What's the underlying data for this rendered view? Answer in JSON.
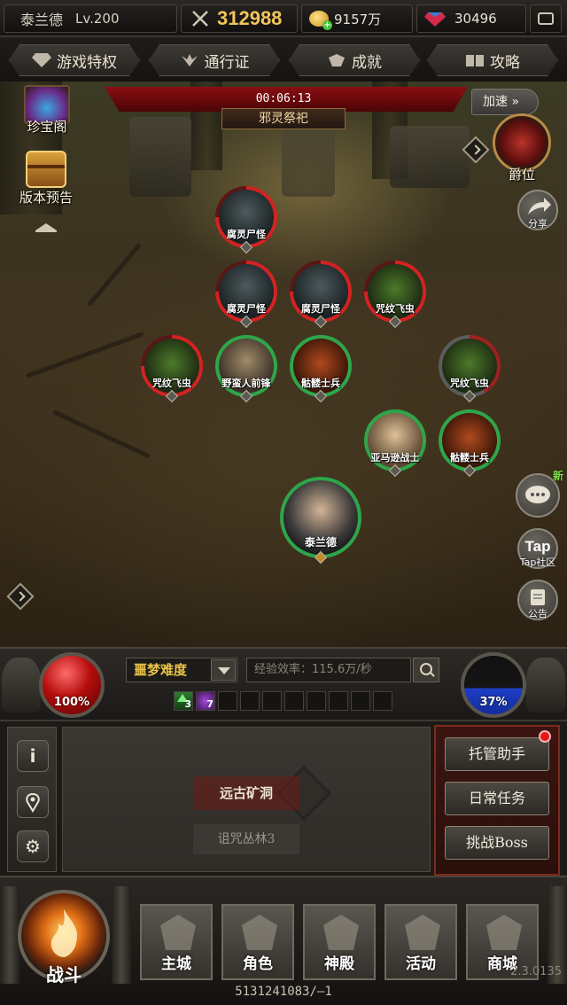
{
  "player": {
    "name": "泰兰德",
    "level": "Lv.200",
    "power": "312988"
  },
  "resources": {
    "gold": "9157万",
    "gems": "30496"
  },
  "nav": [
    "游戏特权",
    "通行证",
    "成就",
    "攻略"
  ],
  "event": {
    "timer": "00:06:13",
    "name": "邪灵祭祀",
    "speedup": "加速 »"
  },
  "side_left": {
    "treasure": "珍宝阁",
    "preview": "版本预告"
  },
  "side_right": {
    "rank": "爵位",
    "share": "分享",
    "chat_new": "新",
    "tap": "Tap",
    "tap_label": "Tap社区",
    "notice": "公告"
  },
  "units": [
    {
      "name": "腐灵尸怪",
      "side": "enemy",
      "face": "ghoul"
    },
    {
      "name": "腐灵尸怪",
      "side": "enemy",
      "face": "ghoul"
    },
    {
      "name": "腐灵尸怪",
      "side": "enemy",
      "face": "ghoul"
    },
    {
      "name": "咒纹飞虫",
      "side": "enemy",
      "face": "bug"
    },
    {
      "name": "咒纹飞虫",
      "side": "enemy",
      "face": "bug"
    },
    {
      "name": "野蛮人前锋",
      "side": "ally",
      "face": "viking"
    },
    {
      "name": "骷髅士兵",
      "side": "ally",
      "face": "skull"
    },
    {
      "name": "咒纹飞虫",
      "side": "enemy-low",
      "face": "bug"
    },
    {
      "name": "亚马逊战士",
      "side": "ally",
      "face": "amazon"
    },
    {
      "name": "骷髅士兵",
      "side": "ally",
      "face": "skull"
    },
    {
      "name": "泰兰德",
      "side": "hero",
      "face": "hero"
    }
  ],
  "hud": {
    "hp": "100%",
    "mp": "37%",
    "difficulty": "噩梦难度",
    "exp": "经验效率：115.6万/秒",
    "buff_up": "3",
    "buff_magic": "7"
  },
  "map": {
    "current": "远古矿洞",
    "next": "诅咒丛林3"
  },
  "actions": [
    "托管助手",
    "日常任务",
    "挑战Boss"
  ],
  "bottom_nav": {
    "fight": "战斗",
    "tiles": [
      "主城",
      "角色",
      "神殿",
      "活动",
      "商城"
    ]
  },
  "footer": {
    "id": "5131241083/—1",
    "version": "2.3.0135"
  },
  "colors": {
    "enemy_ring": "#d32222",
    "ally_ring": "#2fa54a",
    "gold_text": "#f1c55a",
    "difficulty": "#e9c34a"
  }
}
